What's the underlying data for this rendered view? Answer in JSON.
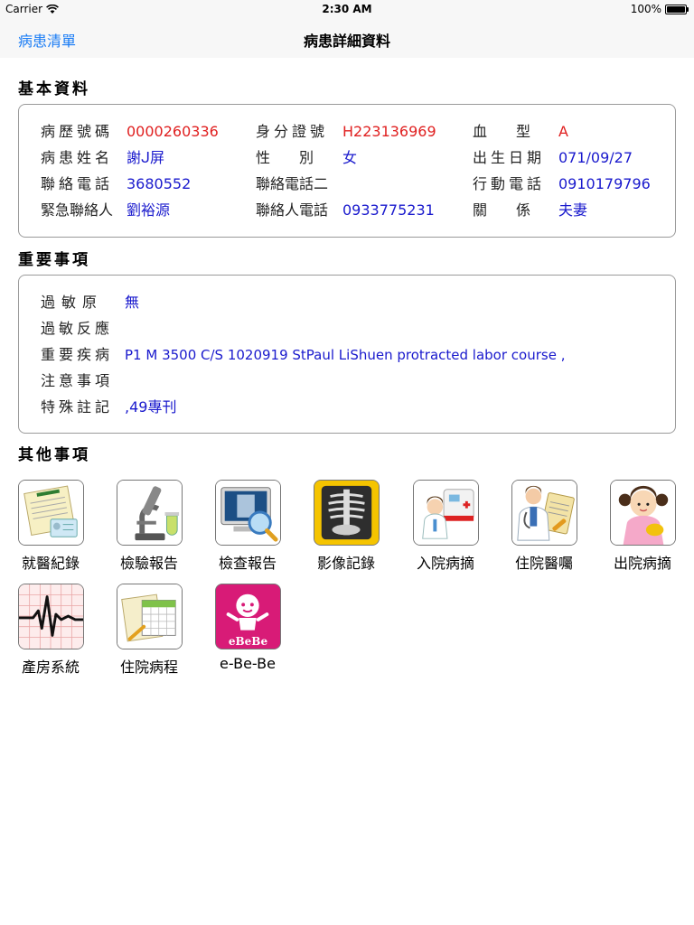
{
  "status": {
    "carrier": "Carrier",
    "time": "2:30 AM",
    "battery": "100%"
  },
  "nav": {
    "back": "病患清單",
    "title": "病患詳細資料"
  },
  "sections": {
    "basic": "基本資料",
    "important": "重要事項",
    "other": "其他事項"
  },
  "basic": {
    "chart_no_label": "病歷號碼",
    "chart_no": "0000260336",
    "id_label": "身分證號",
    "id": "H223136969",
    "blood_label": "血　型",
    "blood": "A",
    "name_label": "病患姓名",
    "name": "謝ᒍ屏",
    "gender_label": "性　別",
    "gender": "女",
    "dob_label": "出生日期",
    "dob": "071/09/27",
    "phone_label": "聯絡電話",
    "phone": "3680552",
    "phone2_label": "聯絡電話二",
    "phone2": "",
    "mobile_label": "行動電話",
    "mobile": "0910179796",
    "emergency_label": "緊急聯絡人",
    "emergency": "劉裕源",
    "contact_phone_label": "聯絡人電話",
    "contact_phone": "0933775231",
    "relation_label": "關　係",
    "relation": "夫妻"
  },
  "important": {
    "allergen_label": "過敏原",
    "allergen": "無",
    "reaction_label": "過敏反應",
    "reaction": "",
    "disease_label": "重要疾病",
    "disease": "P1 M 3500 C/S 1020919 StPaul LiShuen protracted labor course ,",
    "notice_label": "注意事項",
    "notice": "",
    "special_label": "特殊註記",
    "special": ",49專刊"
  },
  "tiles": [
    {
      "label": "就醫紀錄",
      "icon": "medical-record-icon"
    },
    {
      "label": "檢驗報告",
      "icon": "microscope-icon"
    },
    {
      "label": "檢查報告",
      "icon": "xray-monitor-icon"
    },
    {
      "label": "影像記錄",
      "icon": "xray-film-icon"
    },
    {
      "label": "入院病摘",
      "icon": "ambulance-doctor-icon"
    },
    {
      "label": "住院醫囑",
      "icon": "doctor-clipboard-icon"
    },
    {
      "label": "出院病摘",
      "icon": "girl-icon"
    },
    {
      "label": "產房系統",
      "icon": "ecg-icon"
    },
    {
      "label": "住院病程",
      "icon": "calendar-icon"
    },
    {
      "label": "e-Be-Be",
      "icon": "ebebe-icon"
    }
  ],
  "ebebe_logo": "eBeBe",
  "colors": {
    "accent": "#1a7cf5",
    "value_blue": "#1a1acd",
    "value_red": "#e02020"
  }
}
